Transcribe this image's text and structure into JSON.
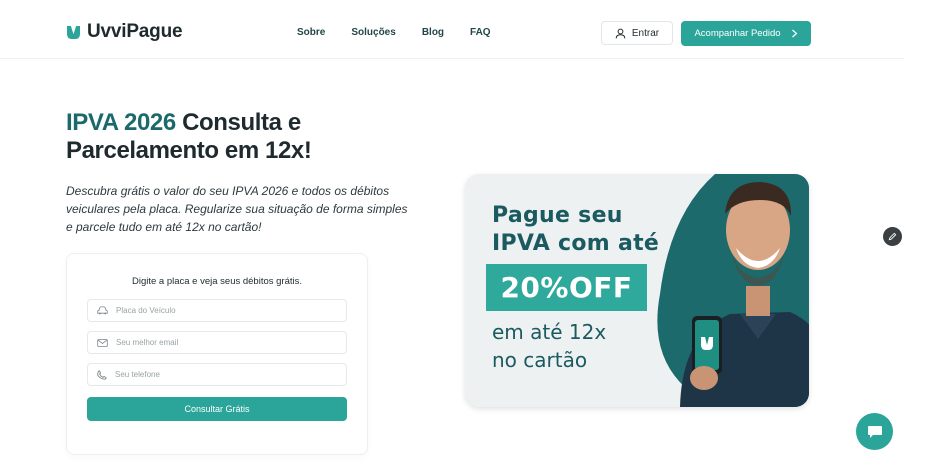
{
  "brand": {
    "name": "UvviPague",
    "color": "#2ba59a"
  },
  "nav": {
    "items": [
      "Sobre",
      "Soluções",
      "Blog",
      "FAQ"
    ]
  },
  "header": {
    "login_label": "Entrar",
    "track_label": "Acompanhar Pedido",
    "login_icon": "user-icon",
    "track_icon": "chevron-right-icon"
  },
  "hero": {
    "title_accent": "IPVA 2026",
    "title_rest": " Consulta e Parcelamento em 12x!",
    "description": "Descubra grátis o valor do seu IPVA 2026 e todos os débitos veiculares pela placa. Regularize sua situação de forma simples e parcele tudo em até 12x no cartão!"
  },
  "form": {
    "title": "Digite a placa e veja seus débitos grátis.",
    "fields": [
      {
        "placeholder": "Placa do Veículo",
        "icon": "car-icon"
      },
      {
        "placeholder": "Seu melhor email",
        "icon": "mail-icon"
      },
      {
        "placeholder": "Seu telefone",
        "icon": "phone-icon"
      }
    ],
    "submit_label": "Consultar Grátis"
  },
  "banner": {
    "line1": "Pague seu",
    "line2": "IPVA com até",
    "offer": "20%OFF",
    "line3": "em até 12x",
    "line4": "no cartão"
  }
}
